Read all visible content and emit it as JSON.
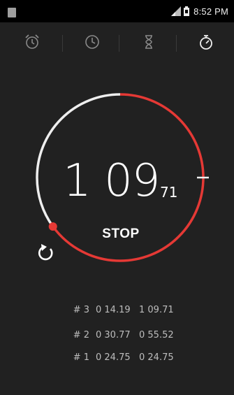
{
  "status_bar": {
    "time": "8:52 PM",
    "icons": [
      "notification-icon",
      "signal-icon",
      "battery-icon"
    ]
  },
  "tabs": [
    {
      "name": "alarm",
      "icon": "alarm-clock-icon",
      "selected": false
    },
    {
      "name": "clock",
      "icon": "clock-icon",
      "selected": false
    },
    {
      "name": "timer",
      "icon": "hourglass-icon",
      "selected": false
    },
    {
      "name": "stopwatch",
      "icon": "stopwatch-icon",
      "selected": true
    }
  ],
  "stopwatch": {
    "seconds": "1 09",
    "hundredths": "71",
    "stop_label": "STOP",
    "reset_icon": "reset-icon",
    "progress_fraction": 0.65
  },
  "laps": [
    {
      "num": "# 3",
      "split": "0 14.19",
      "total": "1 09.71"
    },
    {
      "num": "# 2",
      "split": "0 30.77",
      "total": "0 55.52"
    },
    {
      "num": "# 1",
      "split": "0 24.75",
      "total": "0 24.75"
    }
  ],
  "colors": {
    "background": "#212121",
    "accent": "#e53935",
    "ring_white": "#eeeeee",
    "text_dim": "#bdbdbd"
  }
}
